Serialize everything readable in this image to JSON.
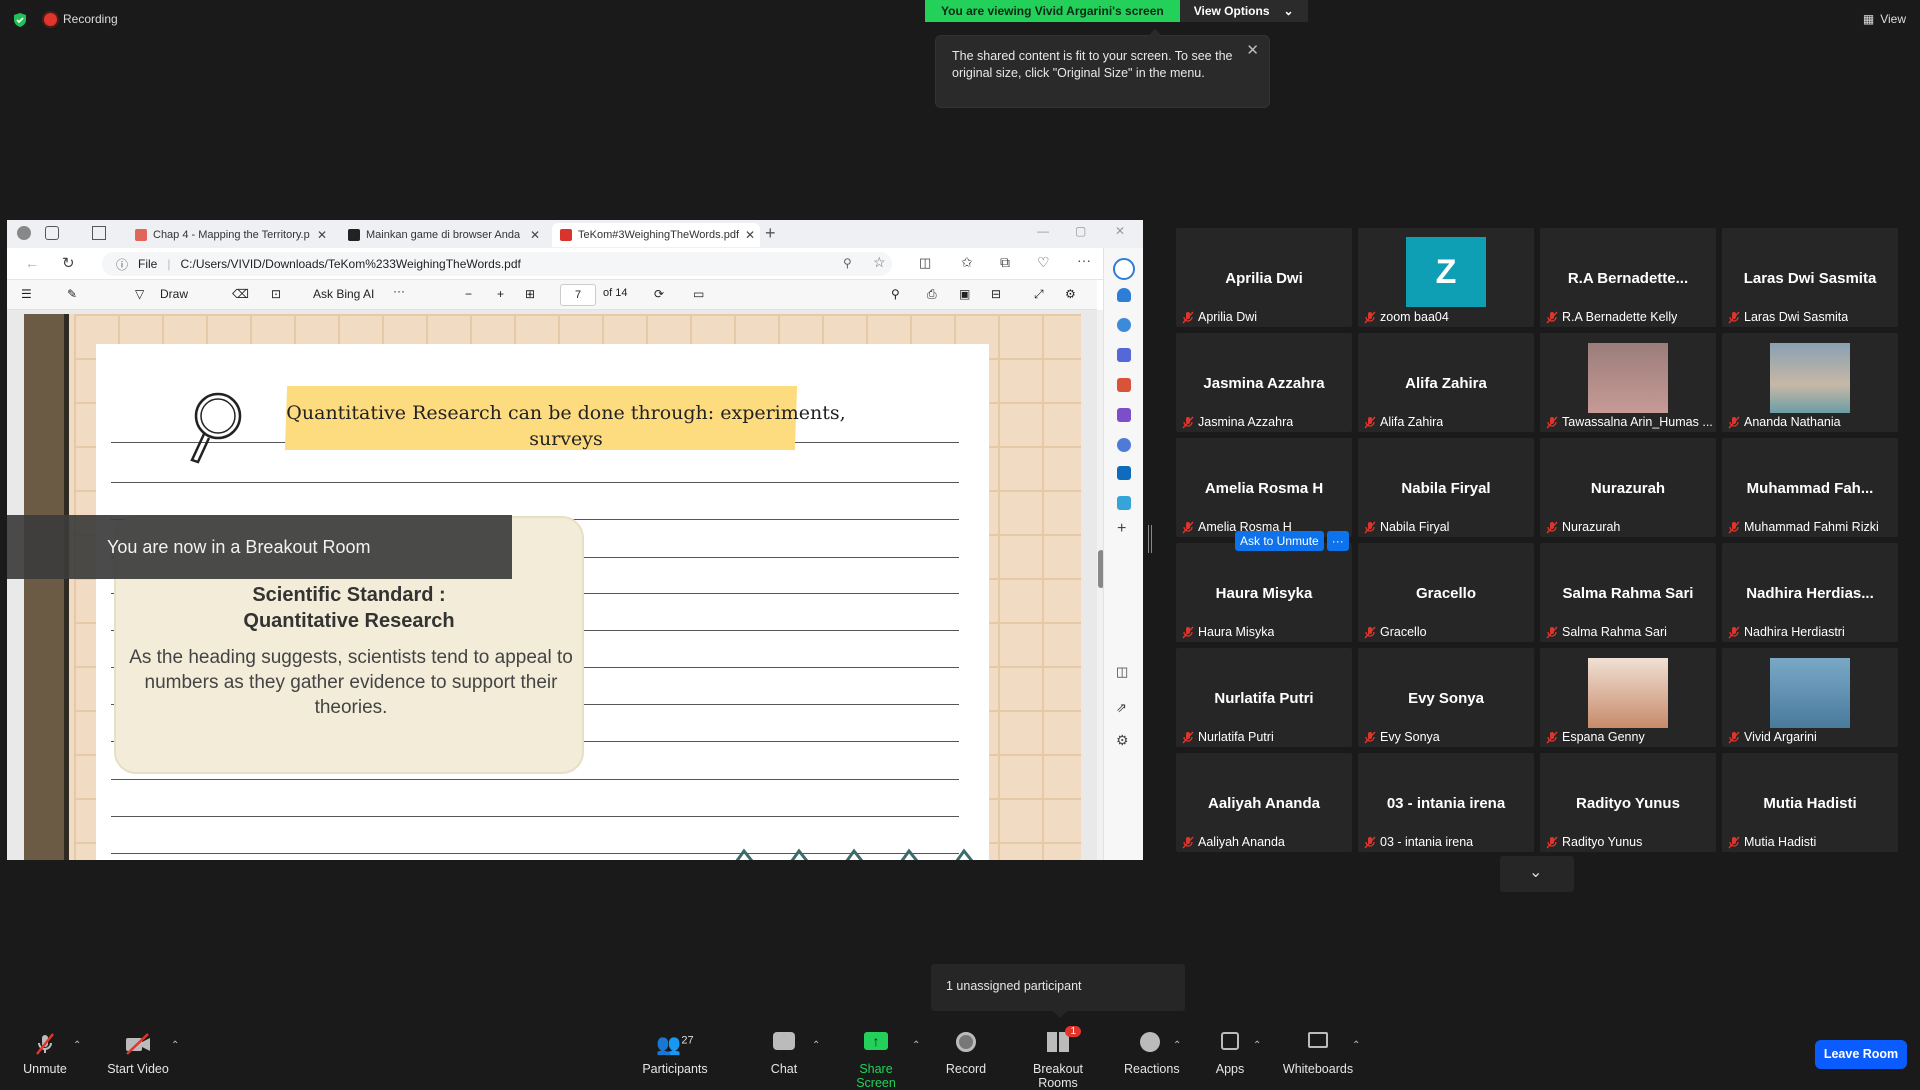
{
  "topbar": {
    "recording_label": "Recording",
    "viewing_label": "You are viewing Vivid Argarini's screen",
    "view_options_label": "View Options",
    "view_label": "View",
    "tooltip_text": "The shared content is fit to your screen. To see the original size, click \"Original Size\" in the menu."
  },
  "browser": {
    "tabs": [
      {
        "label": "Chap 4 - Mapping the Territory.p"
      },
      {
        "label": "Mainkan game di browser Anda"
      },
      {
        "label": "TeKom#3WeighingTheWords.pdf"
      }
    ],
    "url_prefix": "File",
    "url": "C:/Users/VIVID/Downloads/TeKom%233WeighingTheWords.pdf",
    "pdf_toolbar": {
      "draw_label": "Draw",
      "ask_label": "Ask Bing AI",
      "page_value": "7",
      "page_total": "of 14"
    }
  },
  "pdf_page": {
    "heading": "Quantitative Research can be done through: experiments, surveys",
    "note_title_1": "Scientific Standard :",
    "note_title_2": "Quantitative Research",
    "note_body": "As the heading suggests, scientists tend to appeal to numbers as they gather evidence to support their theories."
  },
  "breakout_banner": "You are now in a Breakout Room",
  "gallery": {
    "tiles": [
      {
        "name": "Aprilia Dwi",
        "label": "Aprilia Dwi"
      },
      {
        "name": "Z",
        "label": "zoom baa04",
        "avatar": "letter",
        "avatar_color": "#0f9fb4"
      },
      {
        "name": "R.A  Bernadette...",
        "label": "R.A Bernadette Kelly"
      },
      {
        "name": "Laras Dwi Sasmita",
        "label": "Laras Dwi Sasmita"
      },
      {
        "name": "Jasmina Azzahra",
        "label": "Jasmina Azzahra"
      },
      {
        "name": "Alifa Zahira",
        "label": "Alifa Zahira"
      },
      {
        "name": "",
        "label": "Tawassalna Arin_Humas ...",
        "avatar": "photo"
      },
      {
        "name": "",
        "label": "Ananda Nathania",
        "avatar": "photo"
      },
      {
        "name": "Amelia Rosma H",
        "label": "Amelia Rosma H"
      },
      {
        "name": "Nabila Firyal",
        "label": "Nabila Firyal"
      },
      {
        "name": "Nurazurah",
        "label": "Nurazurah"
      },
      {
        "name": "Muhammad  Fah...",
        "label": "Muhammad Fahmi Rizki"
      },
      {
        "name": "Haura Misyka",
        "label": "Haura Misyka"
      },
      {
        "name": "Gracello",
        "label": "Gracello"
      },
      {
        "name": "Salma Rahma Sari",
        "label": "Salma Rahma Sari"
      },
      {
        "name": "Nadhira  Herdias...",
        "label": "Nadhira Herdiastri"
      },
      {
        "name": "Nurlatifa Putri",
        "label": "Nurlatifa Putri"
      },
      {
        "name": "Evy Sonya",
        "label": "Evy Sonya"
      },
      {
        "name": "",
        "label": "Espana Genny",
        "avatar": "photo"
      },
      {
        "name": "",
        "label": "Vivid Argarini",
        "avatar": "photo"
      },
      {
        "name": "Aaliyah Ananda",
        "label": "Aaliyah Ananda"
      },
      {
        "name": "03 - intania irena",
        "label": "03 - intania irena"
      },
      {
        "name": "Radityo Yunus",
        "label": "Radityo Yunus"
      },
      {
        "name": "Mutia Hadisti",
        "label": "Mutia Hadisti"
      }
    ],
    "ask_to_unmute": "Ask to Unmute",
    "ask_more": "···"
  },
  "popup": "1 unassigned participant",
  "toolbar": {
    "unmute": "Unmute",
    "start_video": "Start Video",
    "participants": "Participants",
    "participants_count": "27",
    "chat": "Chat",
    "share_screen": "Share Screen",
    "record": "Record",
    "breakout_rooms": "Breakout Rooms",
    "breakout_badge": "1",
    "reactions": "Reactions",
    "apps": "Apps",
    "whiteboards": "Whiteboards",
    "leave_room": "Leave Room"
  },
  "colors": {
    "accent_green": "#23d05a",
    "leave_blue": "#0b5cff",
    "mic_muted_red": "#e0352b"
  }
}
